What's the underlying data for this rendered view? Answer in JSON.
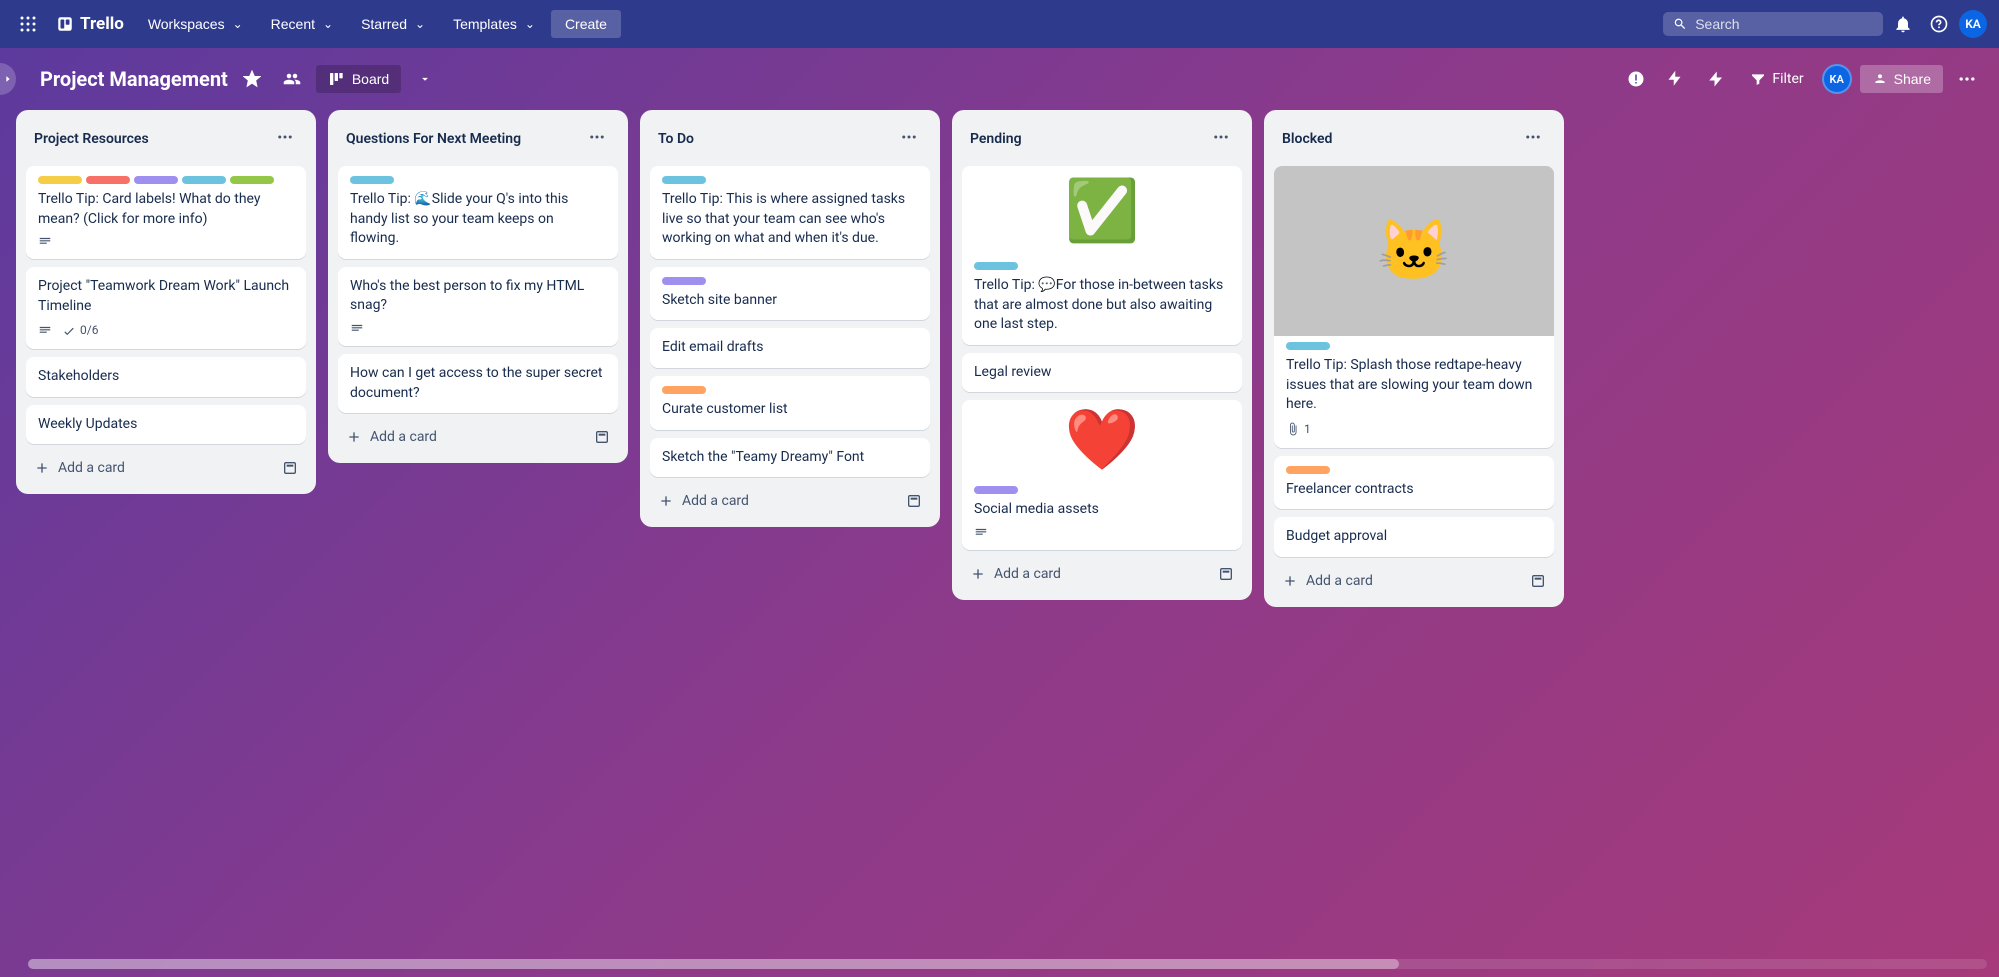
{
  "topbar": {
    "logo": "Trello",
    "nav": [
      "Workspaces",
      "Recent",
      "Starred",
      "Templates"
    ],
    "create": "Create",
    "search_placeholder": "Search",
    "avatar": "KA"
  },
  "boardbar": {
    "title": "Project Management",
    "view": "Board",
    "filter": "Filter",
    "share": "Share",
    "avatar": "KA"
  },
  "lists": [
    {
      "title": "Project Resources",
      "cards": [
        {
          "labels": [
            "yellow",
            "red",
            "purple",
            "sky",
            "green"
          ],
          "text": "Trello Tip: Card labels! What do they mean? (Click for more info)",
          "badges": [
            "desc"
          ]
        },
        {
          "text": "Project \"Teamwork Dream Work\" Launch Timeline",
          "badges": [
            "desc",
            "checklist"
          ],
          "checklist": "0/6"
        },
        {
          "text": "Stakeholders"
        },
        {
          "text": "Weekly Updates"
        }
      ],
      "add": "Add a card"
    },
    {
      "title": "Questions For Next Meeting",
      "cards": [
        {
          "labels": [
            "sky"
          ],
          "text": "Trello Tip: 🌊Slide your Q's into this handy list so your team keeps on flowing."
        },
        {
          "text": "Who's the best person to fix my HTML snag?",
          "badges": [
            "desc"
          ]
        },
        {
          "text": "How can I get access to the super secret document?"
        }
      ],
      "add": "Add a card"
    },
    {
      "title": "To Do",
      "cards": [
        {
          "labels": [
            "sky"
          ],
          "text": "Trello Tip: This is where assigned tasks live so that your team can see who's working on what and when it's due."
        },
        {
          "labels": [
            "purple"
          ],
          "text": "Sketch site banner"
        },
        {
          "text": "Edit email drafts"
        },
        {
          "labels": [
            "orange"
          ],
          "text": "Curate customer list"
        },
        {
          "text": "Sketch the \"Teamy Dreamy\" Font"
        }
      ],
      "add": "Add a card"
    },
    {
      "title": "Pending",
      "cards": [
        {
          "cover": "check",
          "labels": [
            "sky"
          ],
          "text": "Trello Tip: 💬For those in-between tasks that are almost done but also awaiting one last step."
        },
        {
          "text": "Legal review"
        },
        {
          "cover": "heart",
          "labels": [
            "purple"
          ],
          "text": "Social media assets",
          "badges": [
            "desc"
          ]
        }
      ],
      "add": "Add a card"
    },
    {
      "title": "Blocked",
      "cards": [
        {
          "cover": "cat",
          "labels": [
            "sky"
          ],
          "text": "Trello Tip: Splash those redtape-heavy issues that are slowing your team down here.",
          "badges": [
            "attach"
          ],
          "attach": "1"
        },
        {
          "labels": [
            "orange"
          ],
          "text": "Freelancer contracts"
        },
        {
          "text": "Budget approval"
        }
      ],
      "add": "Add a card"
    }
  ]
}
